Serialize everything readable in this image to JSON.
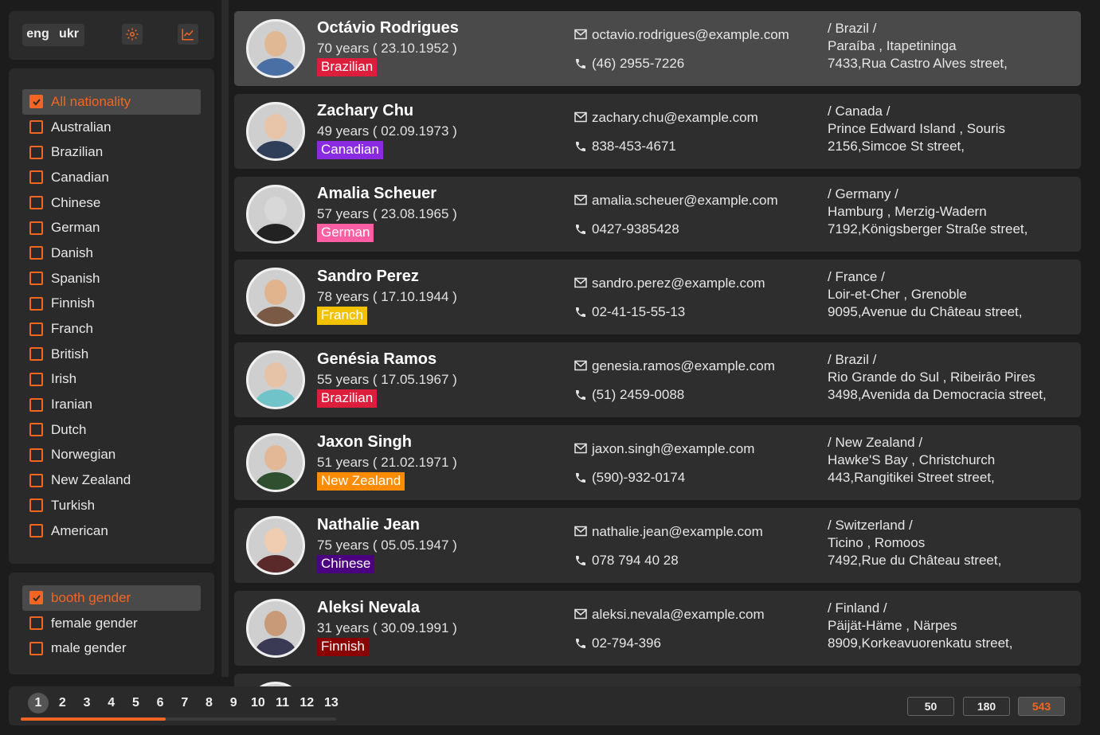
{
  "languages": [
    {
      "label": "eng",
      "active": true
    },
    {
      "label": "ukr",
      "active": false
    }
  ],
  "toolbar": {
    "settings_icon": "gear-icon",
    "stats_icon": "chart-icon"
  },
  "accent_color": "#f26522",
  "nationality_filters": [
    {
      "label": "All nationality",
      "checked": true
    },
    {
      "label": "Australian",
      "checked": false
    },
    {
      "label": "Brazilian",
      "checked": false
    },
    {
      "label": "Canadian",
      "checked": false
    },
    {
      "label": "Chinese",
      "checked": false
    },
    {
      "label": "German",
      "checked": false
    },
    {
      "label": "Danish",
      "checked": false
    },
    {
      "label": "Spanish",
      "checked": false
    },
    {
      "label": "Finnish",
      "checked": false
    },
    {
      "label": "Franch",
      "checked": false
    },
    {
      "label": "British",
      "checked": false
    },
    {
      "label": "Irish",
      "checked": false
    },
    {
      "label": "Iranian",
      "checked": false
    },
    {
      "label": "Dutch",
      "checked": false
    },
    {
      "label": "Norwegian",
      "checked": false
    },
    {
      "label": "New Zealand",
      "checked": false
    },
    {
      "label": "Turkish",
      "checked": false
    },
    {
      "label": "American",
      "checked": false
    }
  ],
  "gender_filters": [
    {
      "label": "booth gender",
      "checked": true
    },
    {
      "label": "female gender",
      "checked": false
    },
    {
      "label": "male gender",
      "checked": false
    }
  ],
  "users": [
    {
      "name": "Octávio Rodrigues",
      "age": "70 years ( 23.10.1952 )",
      "nationality": "Brazilian",
      "badge_color": "#dc1e3c",
      "email": "octavio.rodrigues@example.com",
      "phone": "(46) 2955-7226",
      "country": "/ Brazil /",
      "region": "Paraíba , Itapetininga",
      "street": "7433,Rua Castro Alves street,",
      "highlighted": true,
      "skin": "#e0b893",
      "shirt": "#4a6fa5"
    },
    {
      "name": "Zachary Chu",
      "age": "49 years ( 02.09.1973 )",
      "nationality": "Canadian",
      "badge_color": "#8a2be2",
      "email": "zachary.chu@example.com",
      "phone": "838-453-4671",
      "country": "/ Canada /",
      "region": "Prince Edward Island , Souris",
      "street": "2156,Simcoe St street,",
      "highlighted": false,
      "skin": "#e8c4a8",
      "shirt": "#2f3f5a"
    },
    {
      "name": "Amalia Scheuer",
      "age": "57 years ( 23.08.1965 )",
      "nationality": "German",
      "badge_color": "#ff5fa2",
      "email": "amalia.scheuer@example.com",
      "phone": "0427-9385428",
      "country": "/ Germany /",
      "region": "Hamburg , Merzig-Wadern",
      "street": "7192,Königsberger Straße street,",
      "highlighted": false,
      "skin": "#d8d8d8",
      "shirt": "#222222"
    },
    {
      "name": "Sandro Perez",
      "age": "78 years ( 17.10.1944 )",
      "nationality": "Franch",
      "badge_color": "#f2c200",
      "email": "sandro.perez@example.com",
      "phone": "02-41-15-55-13",
      "country": "/ France /",
      "region": "Loir-et-Cher , Grenoble",
      "street": "9095,Avenue du Château street,",
      "highlighted": false,
      "skin": "#e2b48e",
      "shirt": "#7a5a44"
    },
    {
      "name": "Genésia Ramos",
      "age": "55 years ( 17.05.1967 )",
      "nationality": "Brazilian",
      "badge_color": "#dc1e3c",
      "email": "genesia.ramos@example.com",
      "phone": "(51) 2459-0088",
      "country": "/ Brazil /",
      "region": "Rio Grande do Sul , Ribeirão Pires",
      "street": "3498,Avenida da Democracia street,",
      "highlighted": false,
      "skin": "#e6c2a6",
      "shirt": "#6fc3c9"
    },
    {
      "name": "Jaxon Singh",
      "age": "51 years ( 21.02.1971 )",
      "nationality": "New Zealand",
      "badge_color": "#ff8c00",
      "email": "jaxon.singh@example.com",
      "phone": "(590)-932-0174",
      "country": "/ New Zealand /",
      "region": "Hawke'S Bay , Christchurch",
      "street": "443,Rangitikei Street street,",
      "highlighted": false,
      "skin": "#e3b896",
      "shirt": "#2f4f2f"
    },
    {
      "name": "Nathalie Jean",
      "age": "75 years ( 05.05.1947 )",
      "nationality": "Chinese",
      "badge_color": "#4b0082",
      "email": "nathalie.jean@example.com",
      "phone": "078 794 40 28",
      "country": "/ Switzerland /",
      "region": "Ticino , Romoos",
      "street": "7492,Rue du Château street,",
      "highlighted": false,
      "skin": "#f0cdb0",
      "shirt": "#5a2a2a"
    },
    {
      "name": "Aleksi Nevala",
      "age": "31 years ( 30.09.1991 )",
      "nationality": "Finnish",
      "badge_color": "#8b0000",
      "email": "aleksi.nevala@example.com",
      "phone": "02-794-396",
      "country": "/ Finland /",
      "region": "Päijät-Häme , Närpes",
      "street": "8909,Korkeavuorenkatu street,",
      "highlighted": false,
      "skin": "#c89a78",
      "shirt": "#3a3a55"
    }
  ],
  "pagination": {
    "pages": [
      "1",
      "2",
      "3",
      "4",
      "5",
      "6",
      "7",
      "8",
      "9",
      "10",
      "11",
      "12",
      "13"
    ],
    "current": "1",
    "page_sizes": [
      {
        "label": "50",
        "active": false
      },
      {
        "label": "180",
        "active": false
      },
      {
        "label": "543",
        "active": true
      }
    ]
  }
}
